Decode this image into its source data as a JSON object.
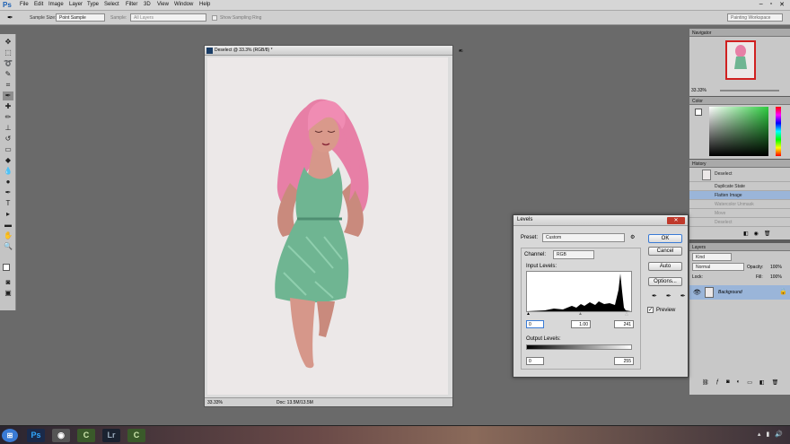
{
  "app": {
    "logo": "Ps",
    "title": "Painting Workspace"
  },
  "menu": [
    "File",
    "Edit",
    "Image",
    "Layer",
    "Type",
    "Select",
    "Filter",
    "3D",
    "View",
    "Window",
    "Help"
  ],
  "options": {
    "sample_size_label": "Sample Size:",
    "sample_size_value": "Point Sample",
    "sample_label": "Sample:",
    "sample_value": "All Layers",
    "show_ring_label": "Show Sampling Ring"
  },
  "document": {
    "title": "Deselect @ 33.3% (RGB/8) *",
    "zoom": "33.33%",
    "doc_info": "Doc: 13.5M/13.5M"
  },
  "navigator": {
    "title": "Navigator",
    "zoom": "33.33%"
  },
  "color_panel": {
    "title": "Color"
  },
  "history": {
    "title": "History",
    "items": [
      "Deselect",
      "Duplicate State",
      "Flatten Image",
      "Watercolor Unmask",
      "Move",
      "Deselect"
    ],
    "active_index": 2
  },
  "layers": {
    "title": "Layers",
    "kind": "Kind",
    "blend": "Normal",
    "opacity_label": "Opacity:",
    "opacity": "100%",
    "lock_label": "Lock:",
    "fill_label": "Fill:",
    "fill": "100%",
    "layer_name": "Background"
  },
  "levels": {
    "title": "Levels",
    "preset_label": "Preset:",
    "preset_value": "Custom",
    "channel_label": "Channel:",
    "channel_value": "RGB",
    "input_label": "Input Levels:",
    "input_black": "0",
    "input_gamma": "1.00",
    "input_white": "241",
    "output_label": "Output Levels:",
    "output_black": "0",
    "output_white": "255",
    "ok": "OK",
    "cancel": "Cancel",
    "auto": "Auto",
    "options": "Options...",
    "preview_label": "Preview",
    "preview_checked": true
  }
}
